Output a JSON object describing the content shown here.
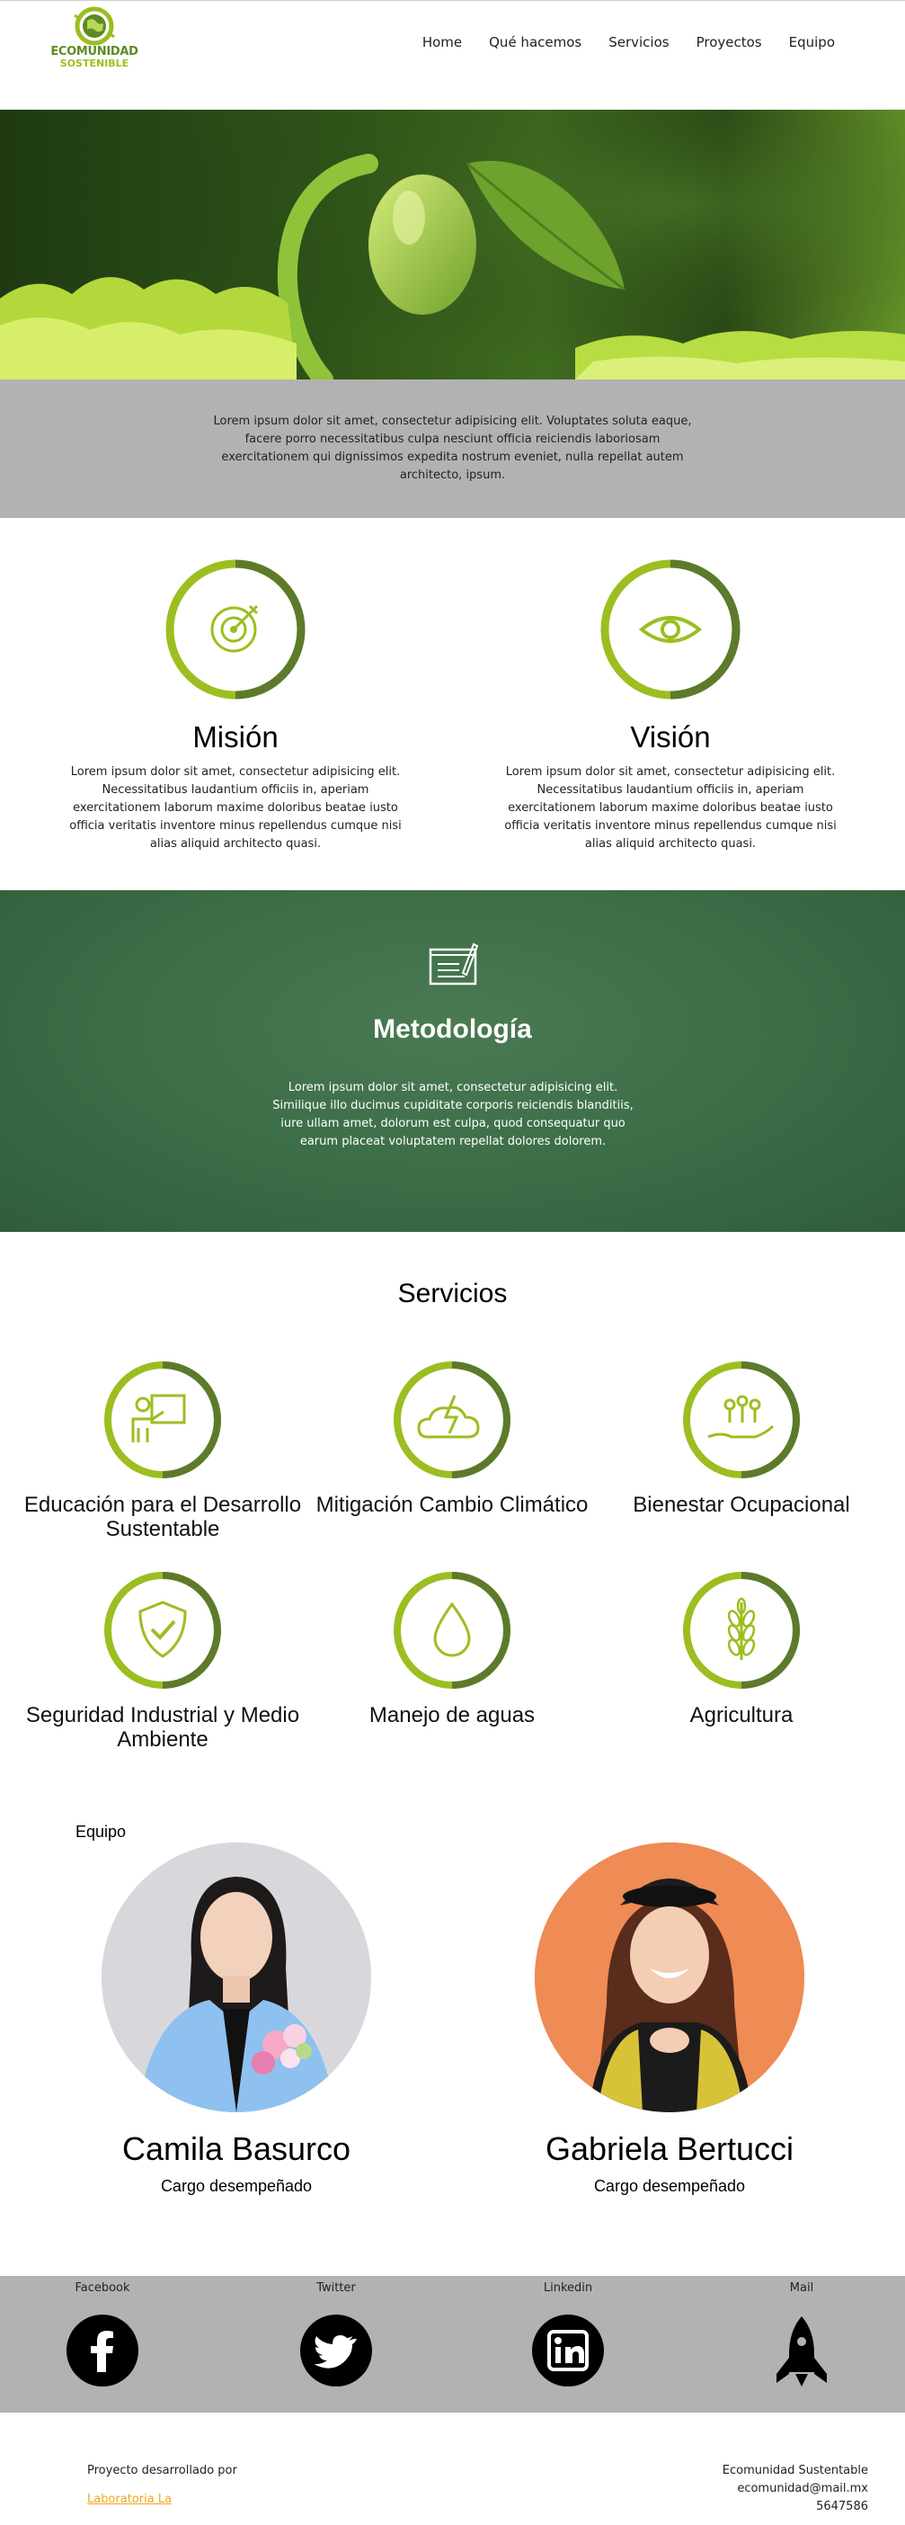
{
  "header": {
    "logo_line1": "ECOMUNIDAD",
    "logo_line2": "SOSTENIBLE",
    "nav": [
      "Home",
      "Qué hacemos",
      "Servicios",
      "Proyectos",
      "Equipo"
    ]
  },
  "intro": {
    "text": "Lorem ipsum dolor sit amet, consectetur adipisicing elit. Voluptates soluta eaque, facere porro necessitatibus culpa nesciunt officia reiciendis laboriosam exercitationem qui dignissimos expedita nostrum eveniet, nulla repellat autem architecto, ipsum."
  },
  "mision": {
    "title": "Misión",
    "text": "Lorem ipsum dolor sit amet, consectetur adipisicing elit. Necessitatibus laudantium officiis in, aperiam exercitationem laborum maxime doloribus beatae iusto officia veritatis inventore minus repellendus cumque nisi alias aliquid architecto quasi.",
    "icon": "target-icon"
  },
  "vision": {
    "title": "Visión",
    "text": "Lorem ipsum dolor sit amet, consectetur adipisicing elit. Necessitatibus laudantium officiis in, aperiam exercitationem laborum maxime doloribus beatae iusto officia veritatis inventore minus repellendus cumque nisi alias aliquid architecto quasi.",
    "icon": "eye-icon"
  },
  "metodologia": {
    "title": "Metodología",
    "text": "Lorem ipsum dolor sit amet, consectetur adipisicing elit. Similique illo ducimus cupiditate corporis reiciendis blanditiis, iure ullam amet, dolorum est culpa, quod consequatur quo earum placeat voluptatem repellat dolores dolorem.",
    "icon": "notebook-pen-icon"
  },
  "servicios": {
    "title": "Servicios",
    "items": [
      {
        "label": "Educación para el Desarrollo Sustentable",
        "icon": "teacher-board-icon"
      },
      {
        "label": "Mitigación Cambio Climático",
        "icon": "cloud-lightning-icon"
      },
      {
        "label": "Bienestar Ocupacional",
        "icon": "hand-people-icon"
      },
      {
        "label": "Seguridad Industrial y Medio Ambiente",
        "icon": "shield-check-icon"
      },
      {
        "label": "Manejo de aguas",
        "icon": "water-drop-icon"
      },
      {
        "label": "Agricultura",
        "icon": "wheat-icon"
      }
    ]
  },
  "equipo": {
    "title": "Equipo",
    "members": [
      {
        "name": "Camila Basurco",
        "role": "Cargo desempeñado"
      },
      {
        "name": "Gabriela Bertucci",
        "role": "Cargo desempeñado"
      }
    ]
  },
  "social": [
    {
      "label": "Facebook",
      "icon": "facebook-icon"
    },
    {
      "label": "Twitter",
      "icon": "twitter-icon"
    },
    {
      "label": "Linkedin",
      "icon": "linkedin-icon"
    },
    {
      "label": "Mail",
      "icon": "rocket-icon"
    }
  ],
  "footer": {
    "left_line": "Proyecto desarrollado por",
    "left_link": "Laboratoria La",
    "right_lines": [
      "Ecomunidad Sustentable",
      "ecomunidad@mail.mx",
      "5647586"
    ]
  },
  "colors": {
    "green_light": "#9cbe20",
    "green_dark": "#5d7a2c",
    "board_green": "#3a6c46",
    "gray_band": "#b2b2b2",
    "link_orange": "#f0a51a"
  }
}
